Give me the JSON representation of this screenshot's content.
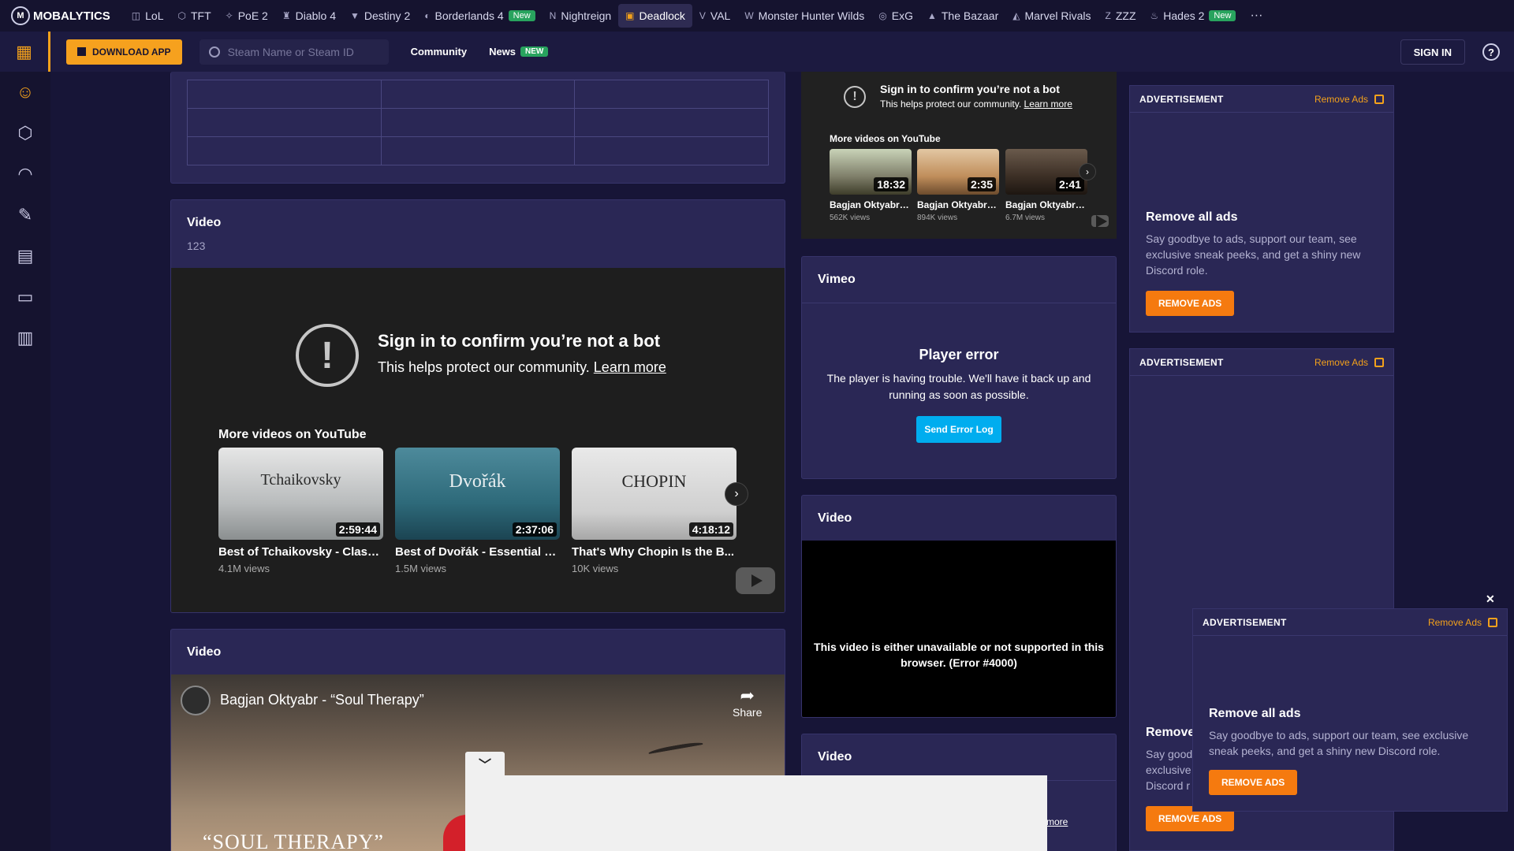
{
  "brand": {
    "name": "MOBALYTICS"
  },
  "games": [
    {
      "label": "LoL",
      "icon": "lol-icon",
      "glyph": "◫",
      "active": false
    },
    {
      "label": "TFT",
      "icon": "tft-icon",
      "glyph": "⬡",
      "active": false
    },
    {
      "label": "PoE 2",
      "icon": "poe2-icon",
      "glyph": "✧",
      "active": false
    },
    {
      "label": "Diablo 4",
      "icon": "diablo4-icon",
      "glyph": "♜",
      "active": false
    },
    {
      "label": "Destiny 2",
      "icon": "destiny2-icon",
      "glyph": "▼",
      "active": false
    },
    {
      "label": "Borderlands 4",
      "icon": "borderlands4-icon",
      "glyph": "◐",
      "active": false,
      "badge": "New"
    },
    {
      "label": "Nightreign",
      "icon": "nightreign-icon",
      "glyph": "N",
      "active": false
    },
    {
      "label": "Deadlock",
      "icon": "deadlock-icon",
      "glyph": "▣",
      "active": true
    },
    {
      "label": "VAL",
      "icon": "valorant-icon",
      "glyph": "V",
      "active": false
    },
    {
      "label": "Monster Hunter Wilds",
      "icon": "mhwilds-icon",
      "glyph": "W",
      "active": false
    },
    {
      "label": "ExG",
      "icon": "exg-icon",
      "glyph": "◎",
      "active": false
    },
    {
      "label": "The Bazaar",
      "icon": "bazaar-icon",
      "glyph": "▲",
      "active": false
    },
    {
      "label": "Marvel Rivals",
      "icon": "marvel-rivals-icon",
      "glyph": "◭",
      "active": false
    },
    {
      "label": "ZZZ",
      "icon": "zzz-icon",
      "glyph": "Z",
      "active": false
    },
    {
      "label": "Hades 2",
      "icon": "hades2-icon",
      "glyph": "♨",
      "active": false,
      "badge": "New"
    }
  ],
  "more_glyph": "···",
  "subbar": {
    "download_label": "DOWNLOAD APP",
    "search_placeholder": "Steam Name or Steam ID",
    "community_label": "Community",
    "news_label": "News",
    "news_badge": "NEW",
    "sign_in_label": "SIGN IN",
    "help_glyph": "?"
  },
  "sidebar": {
    "items": [
      {
        "icon": "dashboard-grid-icon",
        "glyph": "▦"
      },
      {
        "icon": "profile-icon",
        "glyph": "☺"
      },
      {
        "icon": "currency-icon",
        "glyph": "⬡"
      },
      {
        "icon": "heroes-icon",
        "glyph": "◠"
      },
      {
        "icon": "builds-icon",
        "glyph": "✎"
      },
      {
        "icon": "stats-icon",
        "glyph": "▤"
      },
      {
        "icon": "guides-icon",
        "glyph": "▭"
      },
      {
        "icon": "shop-icon",
        "glyph": "▥"
      }
    ]
  },
  "main": {
    "video1": {
      "title": "Video",
      "subtitle": "123",
      "bot_title": "Sign in to confirm you’re not a bot",
      "bot_text": "This helps protect our community.",
      "learn_more": "Learn more",
      "more_videos": "More videos on YouTube",
      "videos": [
        {
          "title": "Best of Tchaikovsky - Class...",
          "views": "4.1M views",
          "duration": "2:59:44",
          "art": "Tchaikovsky"
        },
        {
          "title": "Best of Dvořák - Essential C...",
          "views": "1.5M views",
          "duration": "2:37:06",
          "art": "Dvořák"
        },
        {
          "title": "That's Why Chopin Is the B...",
          "views": "10K views",
          "duration": "4:18:12",
          "art": "CHOPIN"
        }
      ]
    },
    "video2": {
      "title": "Video",
      "player_title": "Bagjan Oktyabr - “Soul Therapy”",
      "share_label": "Share",
      "overlay_text": "“SOUL THERAPY”"
    }
  },
  "middle": {
    "yt_small": {
      "bot_title": "Sign in to confirm you’re not a bot",
      "bot_text": "This helps protect our community.",
      "learn_more": "Learn more",
      "more_videos": "More videos on YouTube",
      "videos": [
        {
          "title": "Bagjan Oktyabr - ...",
          "views": "562K views",
          "duration": "18:32"
        },
        {
          "title": "Bagjan Oktyabr - ...",
          "views": "894K views",
          "duration": "2:35"
        },
        {
          "title": "Bagjan Oktyabr - ...",
          "views": "6.7M views",
          "duration": "2:41"
        }
      ]
    },
    "vimeo": {
      "title": "Vimeo",
      "error_title": "Player error",
      "error_text": "The player is having trouble. We'll have it back up and running as soon as possible.",
      "button": "Send Error Log"
    },
    "video3": {
      "title": "Video",
      "error_text": "This video is either unavailable or not supported in this browser. (Error #4000)"
    },
    "video4": {
      "title": "Video",
      "learn_more_partial": "n more"
    }
  },
  "ads": {
    "label": "ADVERTISEMENT",
    "remove_link": "Remove Ads",
    "heading": "Remove all ads",
    "text": "Say goodbye to ads, support our team, see exclusive sneak peeks, and get a shiny new Discord role.",
    "button": "REMOVE ADS",
    "partial_heading": "Remove",
    "partial_text": "Say good exclusive Discord r",
    "close_glyph": "✕"
  },
  "bottom_bar": {
    "chevron": "﹀"
  },
  "colors": {
    "accent": "#f3a11b",
    "bg": "#171537",
    "card": "#2a2755",
    "yt": "#1e1e1e",
    "vimeo_button": "#00adef"
  }
}
